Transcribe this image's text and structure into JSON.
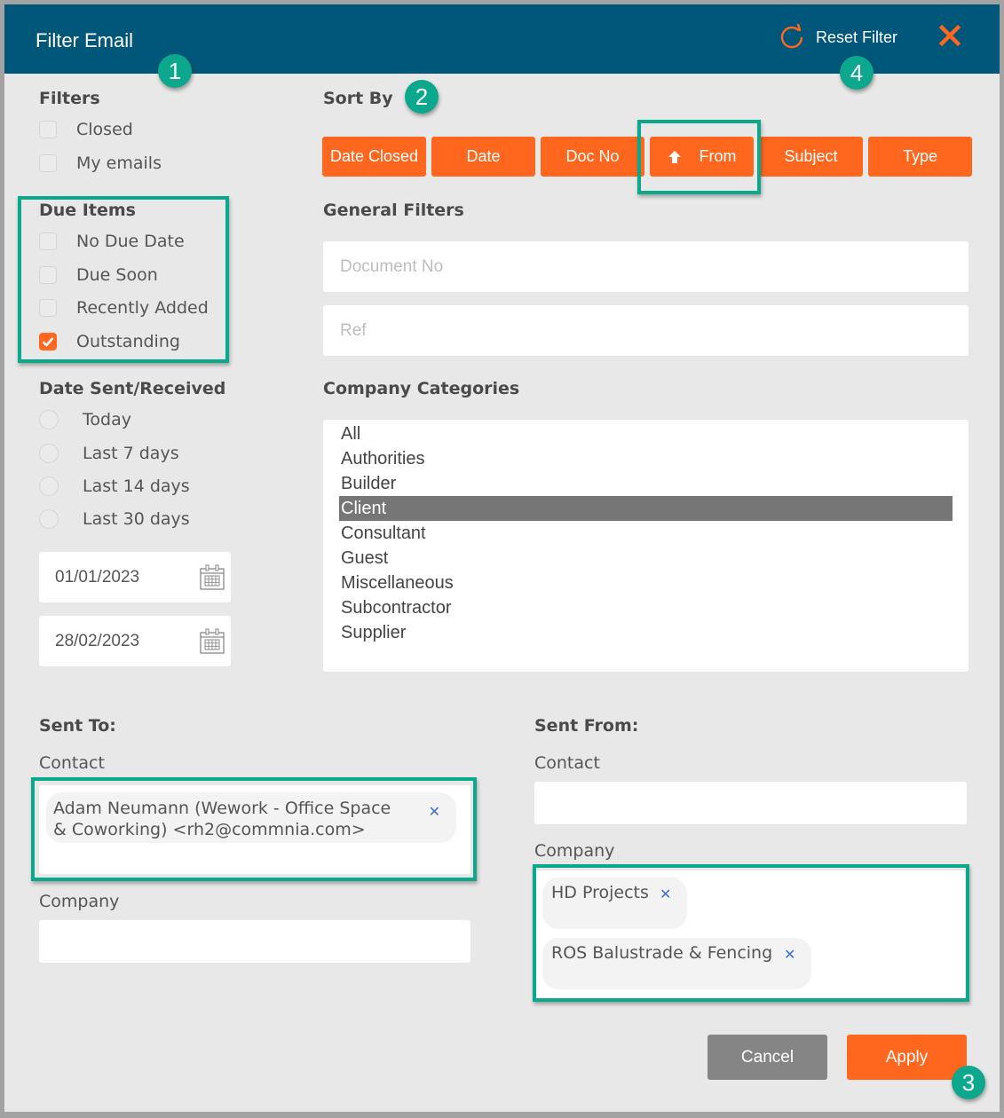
{
  "dialog": {
    "title": "Filter Email",
    "reset_label": "Reset Filter",
    "icons": {
      "reset": "refresh-icon",
      "close": "close-icon"
    }
  },
  "annotations": [
    "1",
    "2",
    "3",
    "4"
  ],
  "filters": {
    "heading": "Filters",
    "items": [
      {
        "label": "Closed",
        "checked": false
      },
      {
        "label": "My emails",
        "checked": false
      }
    ]
  },
  "due_items": {
    "heading": "Due Items",
    "items": [
      {
        "label": "No Due Date",
        "checked": false
      },
      {
        "label": "Due Soon",
        "checked": false
      },
      {
        "label": "Recently Added",
        "checked": false
      },
      {
        "label": "Outstanding",
        "checked": true
      }
    ]
  },
  "date_sent": {
    "heading": "Date Sent/Received",
    "options": [
      {
        "label": "Today",
        "selected": false
      },
      {
        "label": "Last 7 days",
        "selected": false
      },
      {
        "label": "Last 14 days",
        "selected": false
      },
      {
        "label": "Last 30 days",
        "selected": false
      }
    ],
    "from_date": "01/01/2023",
    "to_date": "28/02/2023"
  },
  "sort_by": {
    "heading": "Sort By",
    "buttons": [
      {
        "label": "Date Closed",
        "active": false
      },
      {
        "label": "Date",
        "active": false
      },
      {
        "label": "Doc No",
        "active": false
      },
      {
        "label": "From",
        "active": true,
        "direction": "ascending"
      },
      {
        "label": "Subject",
        "active": false
      },
      {
        "label": "Type",
        "active": false
      }
    ]
  },
  "general_filters": {
    "heading": "General Filters",
    "document_no": {
      "placeholder": "Document No",
      "value": ""
    },
    "ref": {
      "placeholder": "Ref",
      "value": ""
    }
  },
  "company_categories": {
    "heading": "Company Categories",
    "items": [
      "All",
      "Authorities",
      "Builder",
      "Client",
      "Consultant",
      "Guest",
      "Miscellaneous",
      "Subcontractor",
      "Supplier"
    ],
    "selected": "Client"
  },
  "sent_to": {
    "heading": "Sent To:",
    "contact_label": "Contact",
    "contact_tags": [
      "Adam Neumann (Wework - Office Space & Coworking) <rh2@commnia.com>"
    ],
    "company_label": "Company",
    "company_tags": []
  },
  "sent_from": {
    "heading": "Sent From:",
    "contact_label": "Contact",
    "contact_tags": [],
    "company_label": "Company",
    "company_tags": [
      "HD Projects",
      "ROS Balustrade & Fencing"
    ]
  },
  "footer": {
    "cancel_label": "Cancel",
    "apply_label": "Apply"
  },
  "colors": {
    "header": "#00577a",
    "accent": "#ff661e",
    "annotation": "#0ba88e",
    "selected_item": "#767676"
  }
}
